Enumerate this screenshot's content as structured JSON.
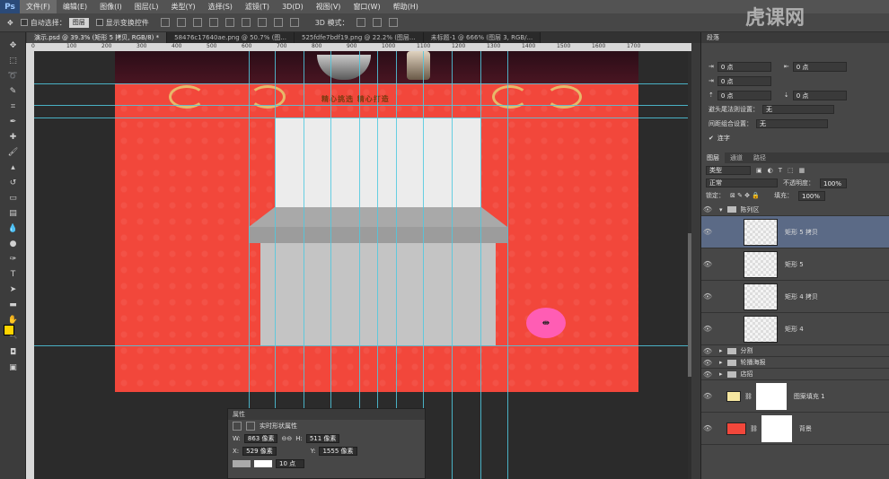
{
  "app": {
    "logo": "Ps"
  },
  "menu": [
    "文件(F)",
    "编辑(E)",
    "图像(I)",
    "图层(L)",
    "类型(Y)",
    "选择(S)",
    "滤镜(T)",
    "3D(D)",
    "视图(V)",
    "窗口(W)",
    "帮助(H)"
  ],
  "options": {
    "auto_select_label": "自动选择：",
    "auto_select_value": "图层",
    "show_transform_label": "显示变换控件",
    "mode_3d_label": "3D 模式："
  },
  "tabs": [
    {
      "label": "演示.psd @ 39.3% (矩形 5 拷贝, RGB/8) *",
      "active": true
    },
    {
      "label": "58476c17640ae.png @ 50.7% (图...",
      "active": false
    },
    {
      "label": "525fdfe7bdf19.png @ 22.2% (图层...",
      "active": false
    },
    {
      "label": "未标题-1 @ 666% (图层 3, RGB/...",
      "active": false
    }
  ],
  "ruler_top": [
    "0",
    "100",
    "200",
    "300",
    "400",
    "500",
    "600",
    "700",
    "800",
    "900",
    "1000",
    "1100",
    "1200",
    "1300",
    "1400",
    "1500",
    "1600",
    "1700"
  ],
  "canvas": {
    "ornament_text": "精心挑选 精心打造"
  },
  "properties_panel": {
    "title": "属性",
    "subtitle": "实时形状属性",
    "w_label": "W:",
    "w_value": "863 像素",
    "h_label": "H:",
    "h_value": "511 像素",
    "x_label": "X:",
    "x_value": "529 像素",
    "y_label": "Y:",
    "y_value": "1555 像素",
    "stroke_value": "10 点"
  },
  "paragraph_panel": {
    "title": "段落",
    "indent_left": "0 点",
    "indent_right": "0 点",
    "indent_first": "0 点",
    "space_before": "0 点",
    "space_after": "0 点",
    "space_after2": "0 点",
    "rules_label": "避头尾法则设置：",
    "rules_value": "无",
    "compose_label": "间距组合设置：",
    "compose_value": "无",
    "hyphen_label": "连字"
  },
  "layers_panel": {
    "tabs": [
      "图层",
      "通道",
      "路径"
    ],
    "filter_label": "类型",
    "blend_mode": "正常",
    "opacity_label": "不透明度：",
    "opacity_value": "100%",
    "lock_label": "锁定：",
    "fill_label": "填充：",
    "fill_value": "100%",
    "group_open": "陈列区",
    "layers": [
      {
        "name": "矩形 5 拷贝",
        "selected": true
      },
      {
        "name": "矩形 5",
        "selected": false
      },
      {
        "name": "矩形 4 拷贝",
        "selected": false
      },
      {
        "name": "矩形 4",
        "selected": false
      }
    ],
    "groups": [
      "分割",
      "轮播海报",
      "店招"
    ],
    "fill_layer": "图案填充 1",
    "bg_layer": "背景"
  },
  "colors": {
    "accent_selected": "#5b6a86",
    "canvas_red": "#f2473b",
    "guide": "#4fc9e0",
    "cursor_highlight": "#ff5db4",
    "foreground": "#ffd400"
  },
  "watermark": "虎课网"
}
